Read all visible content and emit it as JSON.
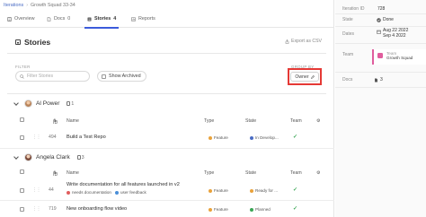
{
  "breadcrumb": {
    "parent": "Iterations",
    "current": "Growth Squad 33-34"
  },
  "tabs": [
    {
      "label": "Overview"
    },
    {
      "label": "Docs",
      "count": "0"
    },
    {
      "label": "Stories",
      "count": "4"
    },
    {
      "label": "Reports"
    }
  ],
  "section": {
    "title": "Stories",
    "export_label": "Export as CSV"
  },
  "filter": {
    "label": "FILTER",
    "search_placeholder": "Filter Stories",
    "show_archived_label": "Show Archived",
    "group_by_label": "GROUP BY",
    "group_by_value": "Owner"
  },
  "table_headers": {
    "id": "ID",
    "name": "Name",
    "type": "Type",
    "state": "State",
    "team": "Team"
  },
  "groups": [
    {
      "owner": "Al Power",
      "story_count": "1",
      "rows": [
        {
          "id": "494",
          "name": "Build a Test Repo",
          "labels": [],
          "type": "Feature",
          "state": "In Develop..."
        }
      ]
    },
    {
      "owner": "Angela Clark",
      "story_count": "3",
      "rows": [
        {
          "id": "44",
          "name": "Write documentation for all features launched in v2",
          "labels": [
            "needs documentation",
            "user feedback"
          ],
          "type": "Feature",
          "state": "Ready for ..."
        },
        {
          "id": "719",
          "name": "New onboarding flow video",
          "labels": [],
          "type": "Feature",
          "state": "Planned"
        }
      ]
    }
  ],
  "sidebar": {
    "iteration_id_label": "Iteration ID",
    "iteration_id": "728",
    "state_label": "State",
    "state_value": "Done",
    "dates_label": "Dates",
    "dates_value_1": "Aug 22 2022",
    "dates_value_2": "Sep 4 2022",
    "team_label": "Team",
    "team_chip_caption": "Team",
    "team_name": "Growth Squad",
    "docs_label": "Docs",
    "docs_count": "3"
  },
  "colors": {
    "accent": "#3b5bdb",
    "link": "#4a6cc4",
    "highlight_box": "#e53935",
    "feature_dot": "#e9a23b",
    "in_dev_state": "#4a6cc4",
    "ready_state": "#e9a23b",
    "planned_state": "#3aa655",
    "label_documentation": "#e05d5d",
    "label_feedback": "#4a8fd8",
    "team_chip": "#e05d9d"
  }
}
